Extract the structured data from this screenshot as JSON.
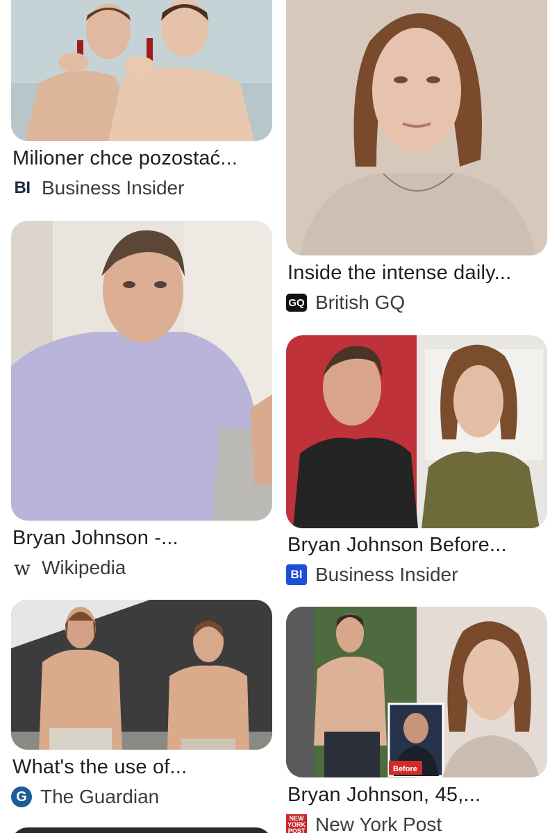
{
  "results": [
    {
      "title": "Milioner chce pozostać...",
      "source": "Business Insider",
      "favicon": "business-insider-plain-logo",
      "favicon_text": "BI",
      "image": "two shirtless men holding vials",
      "overlay": ""
    },
    {
      "title": "Inside the intense daily...",
      "source": "British GQ",
      "favicon": "gq-logo",
      "favicon_text": "GQ",
      "image": "portrait of man with long hair and grey t-shirt",
      "overlay": ""
    },
    {
      "title": "Bryan Johnson -...",
      "source": "Wikipedia",
      "favicon": "wikipedia-logo",
      "favicon_text": "W",
      "image": "man in lavender polo shirt on sofa",
      "overlay": ""
    },
    {
      "title": "Bryan Johnson Before...",
      "source": "Business Insider",
      "favicon": "business-insider-blue-logo",
      "favicon_text": "BI",
      "image": "before and after comparison",
      "overlay": ""
    },
    {
      "title": "What's the use of...",
      "source": "The Guardian",
      "favicon": "guardian-logo",
      "favicon_text": "G",
      "image": "two shirtless men standing outdoors",
      "overlay": ""
    },
    {
      "title": "Bryan Johnson, 45,...",
      "source": "New York Post",
      "favicon": "new-york-post-logo",
      "favicon_text": "NEW YORK POST",
      "image": "shirtless man with before inset and portrait",
      "overlay": "Before"
    }
  ],
  "colors": {
    "background": "#ffffff",
    "title_text": "#1f1f1f",
    "source_text": "#3c3c3c",
    "bi_blue": "#1d4ed8",
    "guardian_blue": "#1d5c96",
    "nypost_red": "#c62828"
  }
}
